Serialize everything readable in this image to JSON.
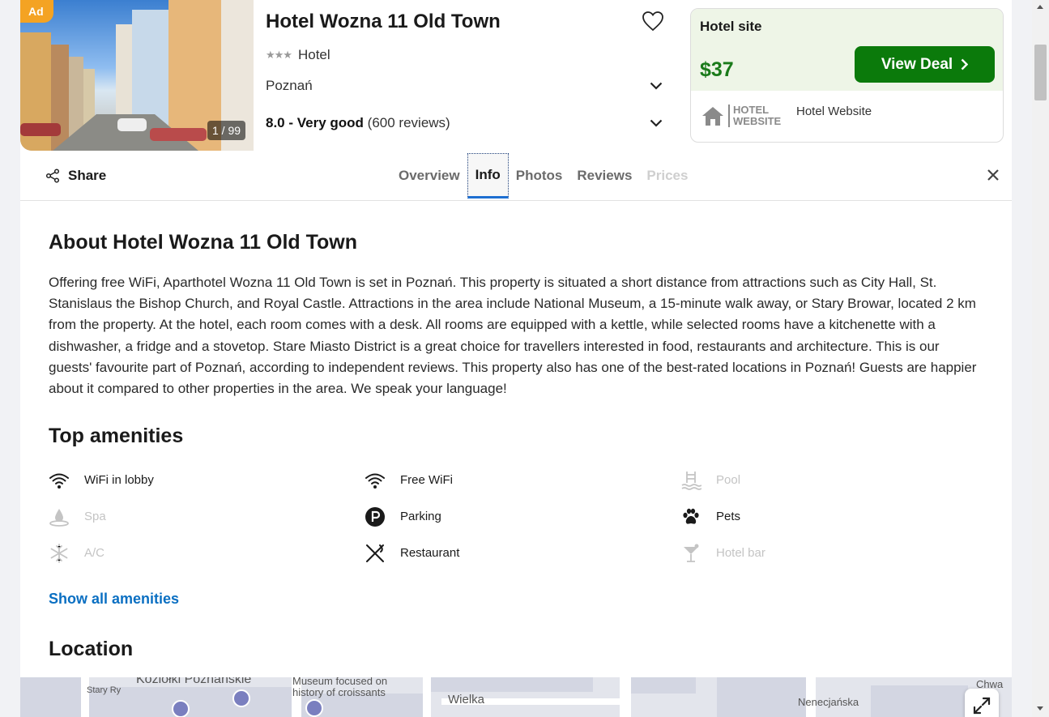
{
  "listing": {
    "ad_badge": "Ad",
    "photo_count": "1 / 99",
    "title": "Hotel Wozna 11 Old Town",
    "stars": "★★★",
    "type": "Hotel",
    "location": "Poznań",
    "rating_score": "8.0 - Very good",
    "rating_reviews": "(600 reviews)"
  },
  "deal": {
    "site_label": "Hotel site",
    "price": "$37",
    "button_label": "View Deal",
    "provider_logo_line1": "HOTEL",
    "provider_logo_line2": "WEBSITE",
    "provider_name": "Hotel Website"
  },
  "tabbar": {
    "share_label": "Share",
    "tabs": [
      {
        "label": "Overview",
        "state": "normal"
      },
      {
        "label": "Info",
        "state": "active"
      },
      {
        "label": "Photos",
        "state": "normal"
      },
      {
        "label": "Reviews",
        "state": "normal"
      },
      {
        "label": "Prices",
        "state": "disabled"
      }
    ]
  },
  "about": {
    "title": "About Hotel Wozna 11 Old Town",
    "text": "Offering free WiFi, Aparthotel Wozna 11 Old Town is set in Poznań. This property is situated a short distance from attractions such as City Hall, St. Stanislaus the Bishop Church, and Royal Castle. Attractions in the area include National Museum, a 15-minute walk away, or Stary Browar, located 2 km from the property. At the hotel, each room comes with a desk. All rooms are equipped with a kettle, while selected rooms have a kitchenette with a dishwasher, a fridge and a stovetop. Stare Miasto District is a great choice for travellers interested in food, restaurants and architecture. This is our guests' favourite part of Poznań, according to independent reviews. This property also has one of the best-rated locations in Poznań! Guests are happier about it compared to other properties in the area. We speak your language!"
  },
  "amenities": {
    "title": "Top amenities",
    "items": [
      {
        "label": "WiFi in lobby",
        "icon": "wifi-icon",
        "available": true
      },
      {
        "label": "Free WiFi",
        "icon": "wifi-icon",
        "available": true
      },
      {
        "label": "Pool",
        "icon": "pool-icon",
        "available": false
      },
      {
        "label": "Spa",
        "icon": "spa-icon",
        "available": false
      },
      {
        "label": "Parking",
        "icon": "parking-icon",
        "available": true
      },
      {
        "label": "Pets",
        "icon": "paw-icon",
        "available": true
      },
      {
        "label": "A/C",
        "icon": "snowflake-icon",
        "available": false
      },
      {
        "label": "Restaurant",
        "icon": "fork-knife-icon",
        "available": true
      },
      {
        "label": "Hotel bar",
        "icon": "cocktail-icon",
        "available": false
      }
    ],
    "show_all": "Show all amenities"
  },
  "location": {
    "title": "Location",
    "map_labels": {
      "poi1": "Koziołki Poznańskie",
      "poi2_line1": "Museum focused on",
      "poi2_line2": "history of croissants",
      "street1": "Wielka",
      "street2": "Nenecjańska",
      "street3": "Chwa",
      "street4": "Stary Ry"
    }
  },
  "colors": {
    "accent_green": "#0b7a0b",
    "price_green": "#1a7a1a",
    "link_blue": "#0a6fc2",
    "ad_orange": "#f4a323"
  }
}
